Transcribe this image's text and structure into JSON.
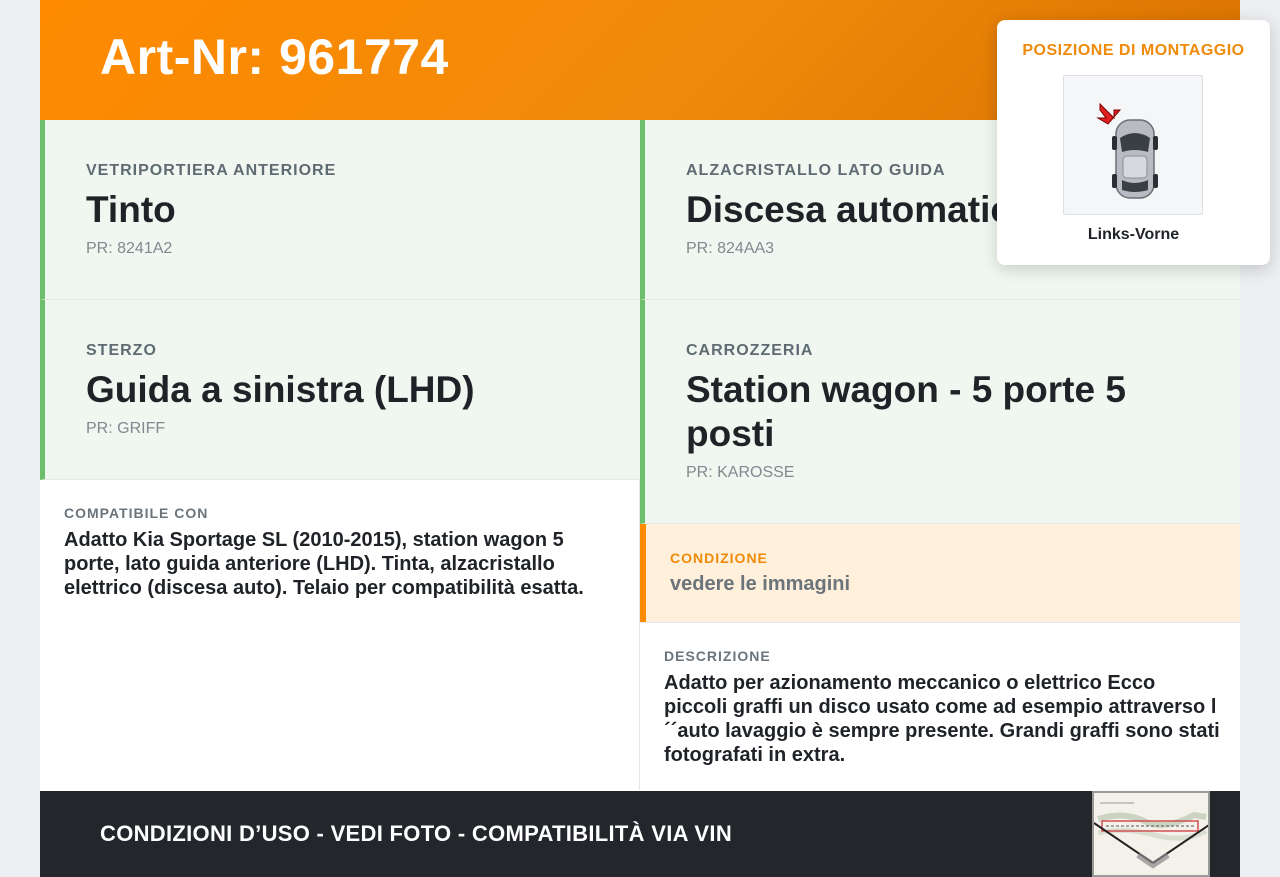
{
  "header": {
    "title": "Art-Nr: 961774"
  },
  "specs": [
    {
      "label": "VETRIPORTIERA ANTERIORE",
      "value": "Tinto",
      "pr": "PR: 8241A2"
    },
    {
      "label": "ALZACRISTALLO LATO GUIDA",
      "value": "Discesa automatica",
      "pr": "PR: 824AA3"
    },
    {
      "label": "STERZO",
      "value": "Guida a sinistra (LHD)",
      "pr": "PR: GRIFF"
    },
    {
      "label": "CARROZZERIA",
      "value": "Station wagon - 5 porte 5 posti",
      "pr": "PR: KAROSSE"
    }
  ],
  "compat": {
    "label": "COMPATIBILE CON",
    "text": "Adatto Kia Sportage SL (2010-2015), station wagon 5 porte, lato guida anteriore (LHD). Tinta, alzacristallo elettrico (discesa auto). Telaio per compatibilità esatta."
  },
  "condition": {
    "label": "CONDIZIONE",
    "value": "vedere le immagini"
  },
  "description": {
    "label": "DESCRIZIONE",
    "text": "Adatto per azionamento meccanico o elettrico Ecco piccoli graffi un disco usato come ad esempio attraverso l´´auto lavaggio è sempre presente. Grandi graffi sono stati fotografati in extra."
  },
  "mount": {
    "title": "POSIZIONE DI MONTAGGIO",
    "position": "Links-Vorne",
    "icon": "car-top-view-icon"
  },
  "footer": {
    "text": "CONDIZIONI D’USO - VEDI FOTO - COMPATIBILITÀ VIA VIN",
    "thumb_icon": "vehicle-document-icon"
  },
  "colors": {
    "accent": "#ff8c00",
    "green_border": "#6dbf6d",
    "footer_bg": "#23262b"
  }
}
